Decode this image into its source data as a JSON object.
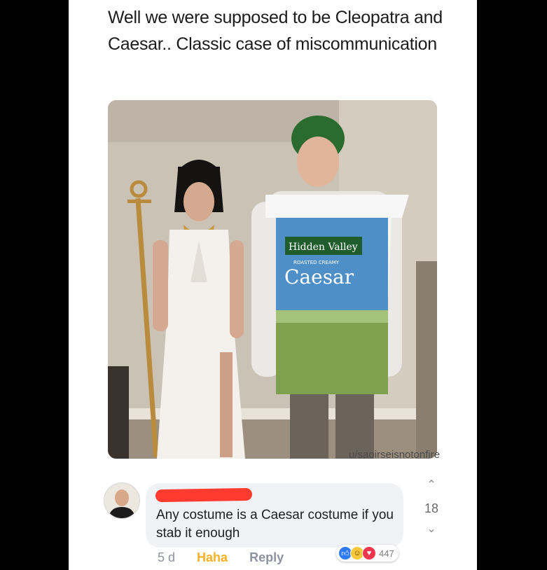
{
  "post": {
    "text": "Well we were supposed to be Cleopatra and Caesar.. Classic case of miscommunication",
    "image_alt": "Couple in Cleopatra costume and Hidden Valley Caesar dressing bottle costume",
    "packet_brand": "Hidden Valley",
    "packet_sub": "ROASTED CREAMY",
    "packet_name": "Caesar",
    "watermark": "u/saoirseisnotonfire"
  },
  "comment": {
    "avatar_icon": "person-avatar",
    "author_redacted": true,
    "text": "Any costume is a Caesar costume if you stab it enough",
    "time": "5 d",
    "react_label": "Haha",
    "reply_label": "Reply",
    "reaction_count": "447",
    "reaction_icons": [
      "like-icon",
      "haha-icon",
      "love-icon"
    ]
  },
  "vote": {
    "up_icon": "chevron-up-icon",
    "count": "18",
    "down_icon": "chevron-down-icon"
  },
  "colors": {
    "haha": "#f7b125",
    "redaction": "#ff3b2f",
    "bubble": "#f1f2f6"
  }
}
